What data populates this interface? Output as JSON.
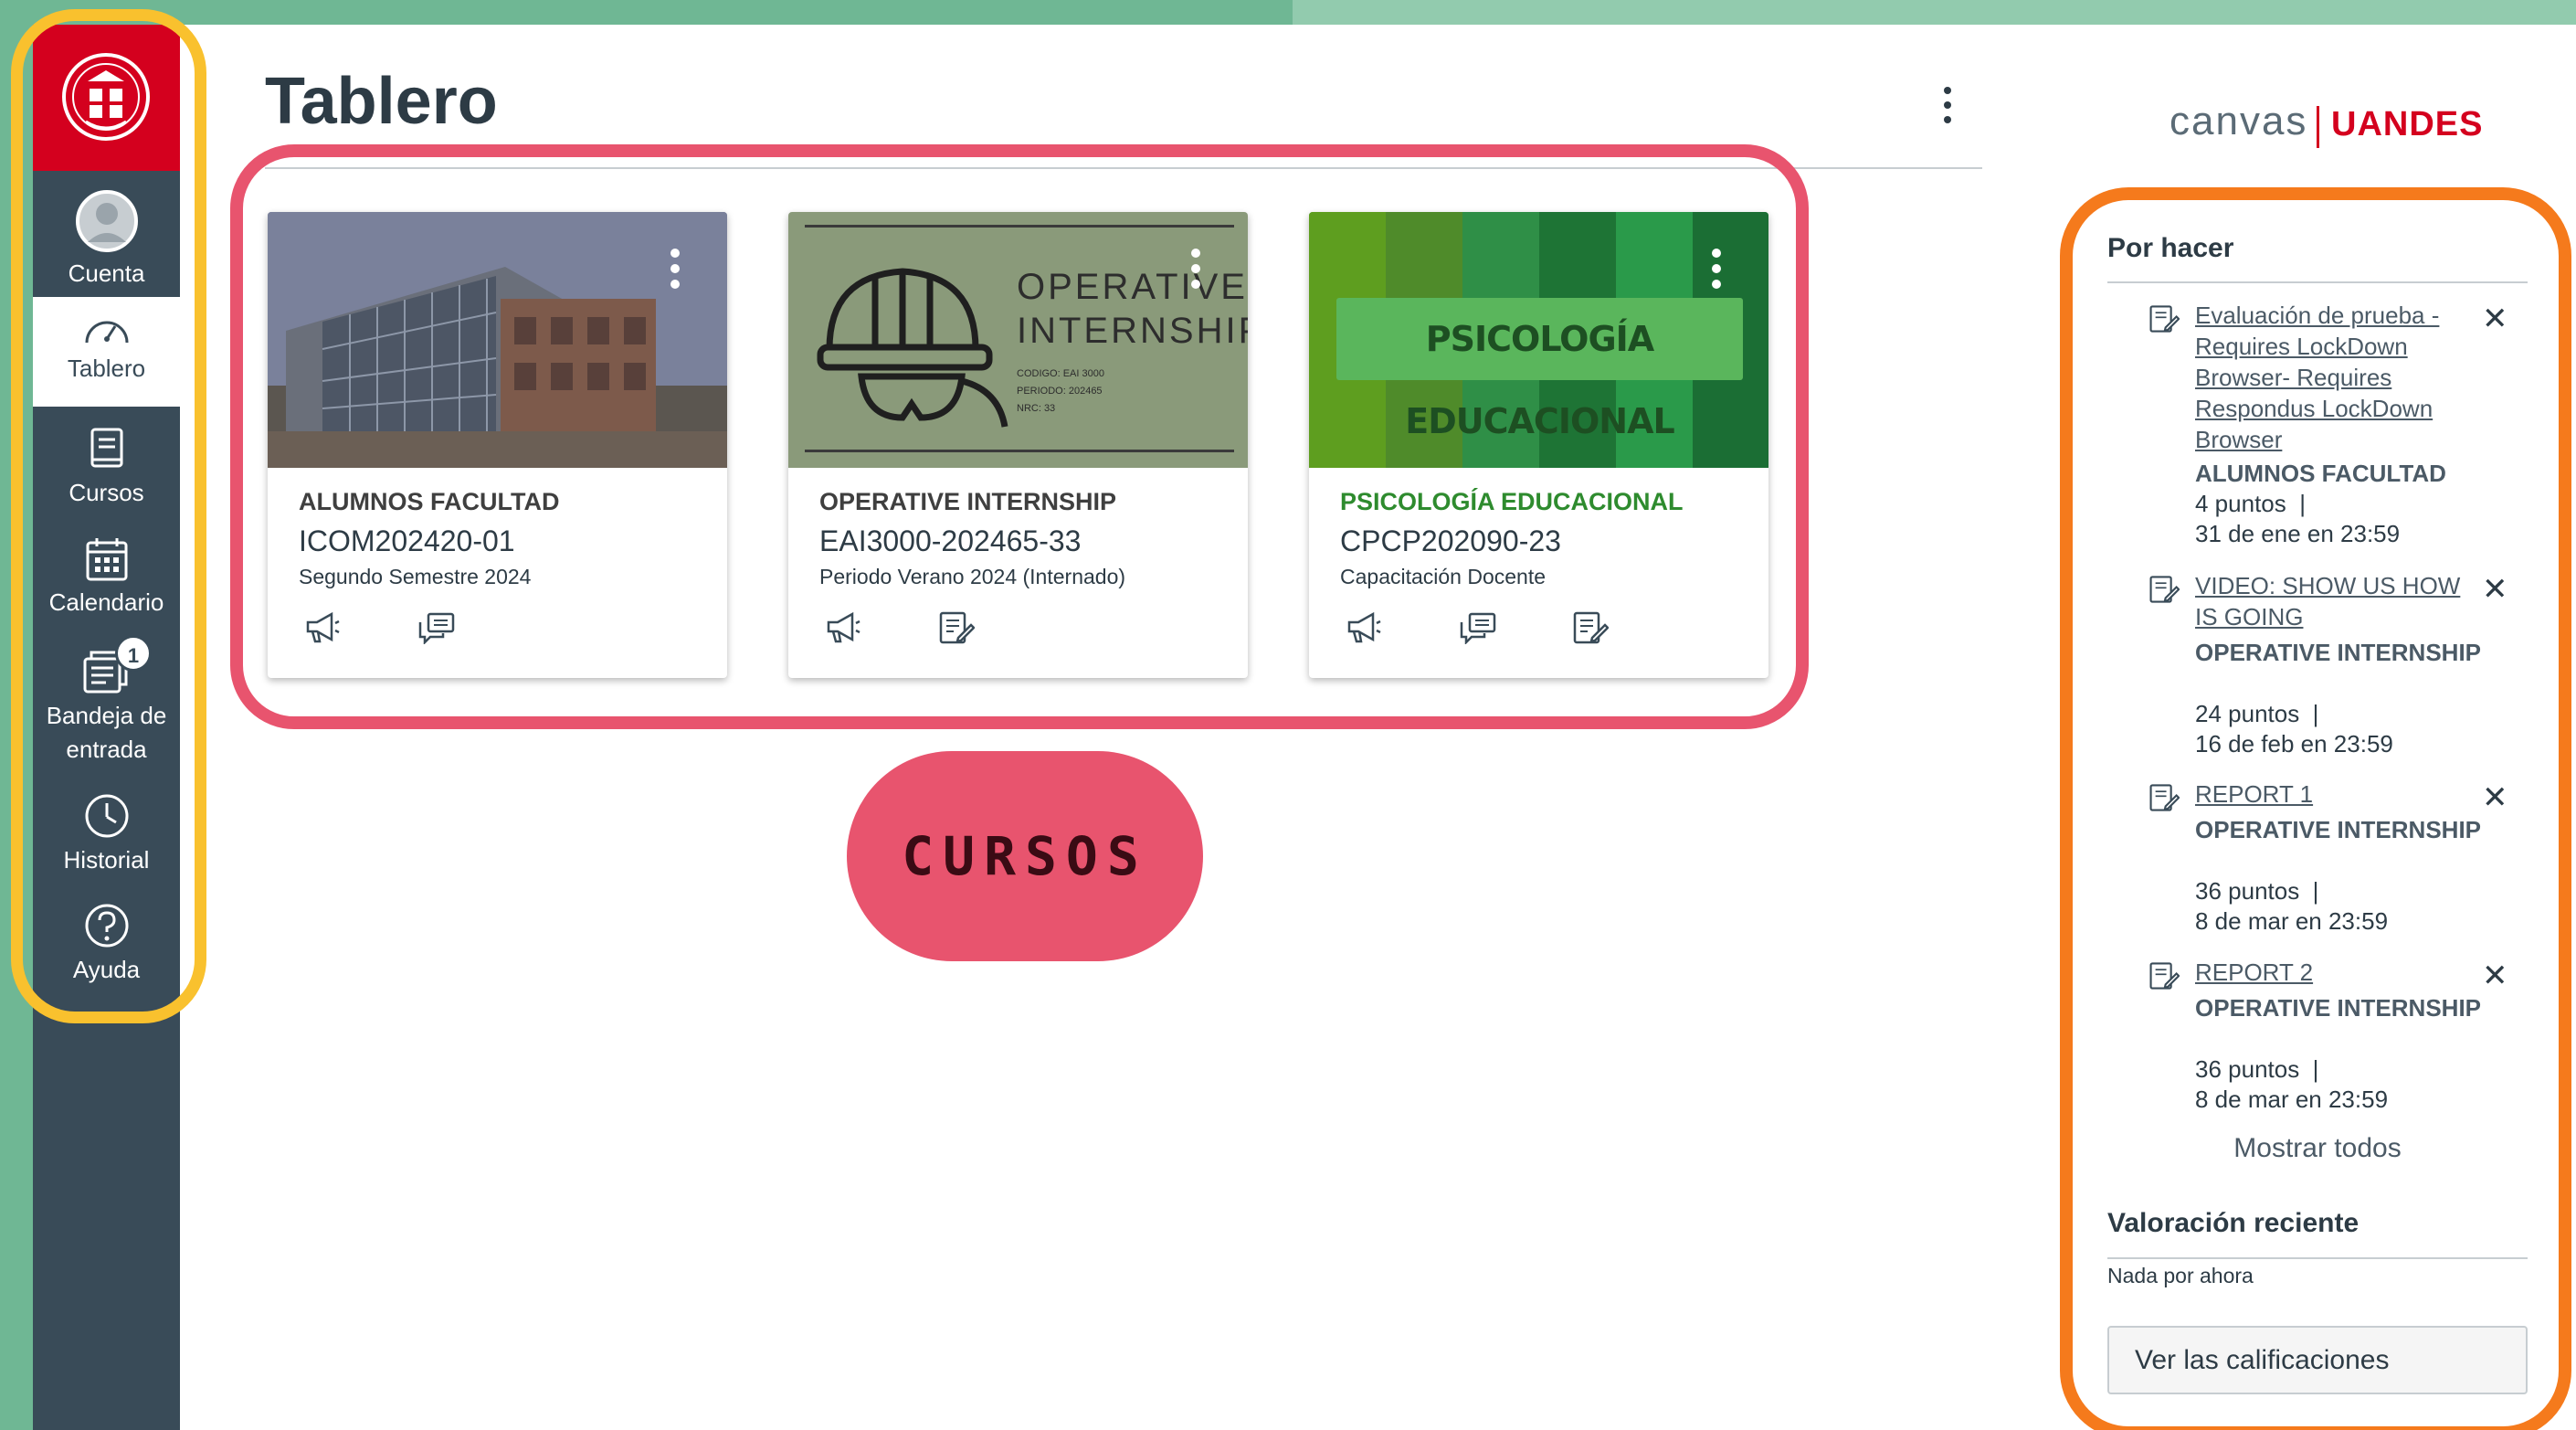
{
  "nav": {
    "logo_text": "UNIVERSIDAD DE LOS ANDES · CHILE",
    "items": [
      {
        "label": "Cuenta"
      },
      {
        "label": "Tablero"
      },
      {
        "label": "Cursos"
      },
      {
        "label": "Calendario"
      },
      {
        "label": "Bandeja de entrada",
        "badge": "1"
      },
      {
        "label": "Historial"
      },
      {
        "label": "Ayuda"
      }
    ],
    "active": "Tablero"
  },
  "header": {
    "title": "Tablero",
    "brand_canvas": "canvas",
    "brand_uandes": "UANDES"
  },
  "courses": [
    {
      "name": "ALUMNOS FACULTAD",
      "code": "ICOM202420-01",
      "term": "Segundo Semestre 2024",
      "name_color": "#3f3f3f"
    },
    {
      "name": "OPERATIVE INTERNSHIP",
      "code": "EAI3000-202465-33",
      "term": "Periodo Verano 2024 (Internado)",
      "hero_title_1": "OPERATIVE",
      "hero_title_2": "INTERNSHIP",
      "hero_small_1": "CODIGO: EAI 3000",
      "hero_small_2": "PERIODO: 202465",
      "hero_small_3": "NRC: 33",
      "name_color": "#3f3f3f"
    },
    {
      "name": "PSICOLOGÍA EDUCACIONAL",
      "code": "CPCP202090-23",
      "term": "Capacitación Docente",
      "hero_title": "PSICOLOGÍA EDUCACIONAL",
      "name_color": "#2e8b2e"
    }
  ],
  "callout": {
    "label": "CURSOS"
  },
  "todo": {
    "heading": "Por hacer",
    "items": [
      {
        "title": "Evaluación de prueba - Requires LockDown Browser- Requires Respondus LockDown Browser",
        "course": "ALUMNOS FACULTAD",
        "points": "4 puntos",
        "due": "31 de ene en 23:59"
      },
      {
        "title": "VIDEO: SHOW US HOW IS GOING",
        "course": "OPERATIVE INTERNSHIP",
        "points": "24 puntos",
        "due": "16 de feb en 23:59"
      },
      {
        "title": "REPORT 1",
        "course": "OPERATIVE INTERNSHIP",
        "points": "36 puntos",
        "due": "8 de mar en 23:59"
      },
      {
        "title": "REPORT 2",
        "course": "OPERATIVE INTERNSHIP",
        "points": "36 puntos",
        "due": "8 de mar en 23:59"
      }
    ],
    "separator": "|",
    "close_glyph": "✕",
    "show_all": "Mostrar todos"
  },
  "grades": {
    "heading": "Valoración reciente",
    "empty": "Nada por ahora",
    "button": "Ver las calificaciones"
  },
  "colors": {
    "nav_bg": "#394b58",
    "logo_red": "#d4001e",
    "highlight_yellow": "#f9c12e",
    "highlight_pink": "#e8546e",
    "highlight_orange": "#f57a1c",
    "frame_green": "#6fb794"
  }
}
